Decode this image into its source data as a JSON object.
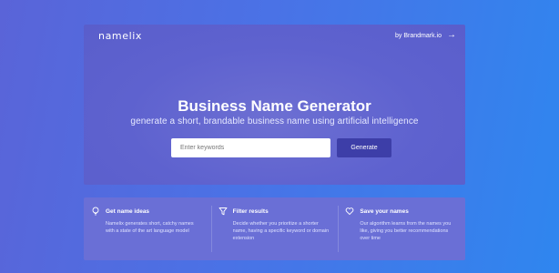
{
  "header": {
    "logo": "namelix",
    "byline": "by Brandmark.io",
    "byline_arrow": "→"
  },
  "hero": {
    "title": "Business Name Generator",
    "subtitle": "generate a short, brandable business name using artificial intelligence",
    "search_placeholder": "Enter keywords",
    "search_value": "",
    "generate_label": "Generate"
  },
  "features": [
    {
      "icon": "lightbulb-icon",
      "title": "Get name ideas",
      "description": "Namelix generates short, catchy names with a state of the art language model"
    },
    {
      "icon": "filter-icon",
      "title": "Filter results",
      "description": "Decide whether you prioritize a shorter name, having a specific keyword or domain extension"
    },
    {
      "icon": "heart-icon",
      "title": "Save your names",
      "description": "Our algorithm learns from the names you like, giving you better recommendations over time"
    }
  ],
  "colors": {
    "background_start": "#5a64d8",
    "background_end": "#2f86ef",
    "panel": "#5e62cf",
    "button": "#3d3ea8"
  }
}
